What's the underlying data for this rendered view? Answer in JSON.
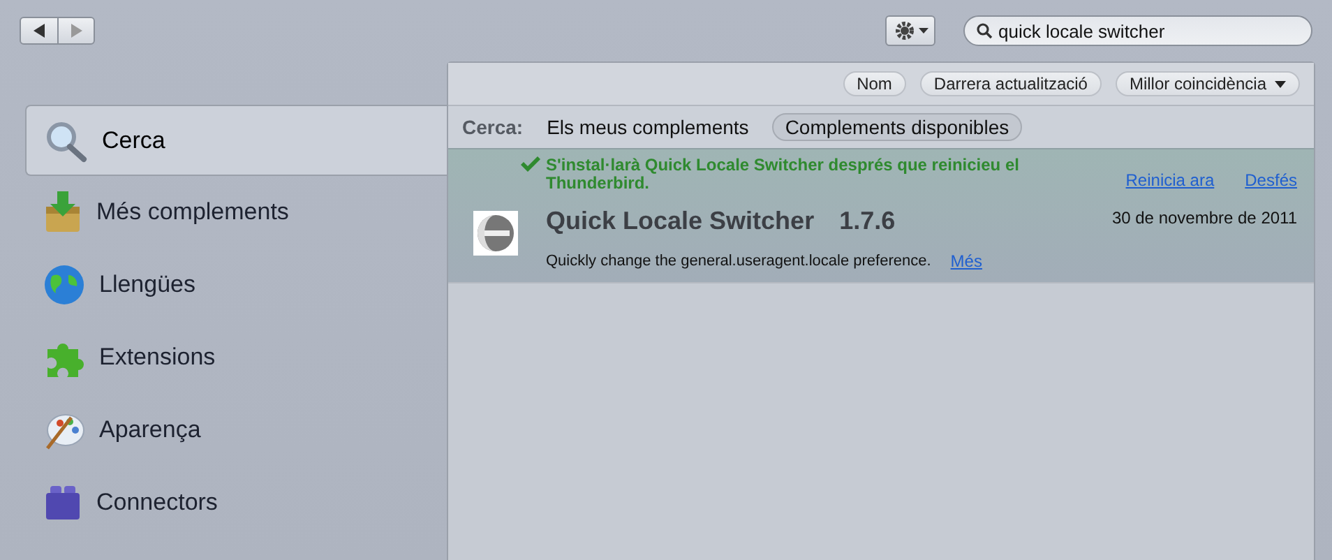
{
  "toolbar": {
    "search": {
      "value": "quick locale switcher"
    }
  },
  "sidebar": {
    "items": [
      {
        "label": "Cerca",
        "selected": true
      },
      {
        "label": "Més complements",
        "selected": false
      },
      {
        "label": "Llengües",
        "selected": false
      },
      {
        "label": "Extensions",
        "selected": false
      },
      {
        "label": "Aparença",
        "selected": false
      },
      {
        "label": "Connectors",
        "selected": false
      }
    ]
  },
  "sort_buttons": [
    {
      "label": "Nom",
      "dropdown": false
    },
    {
      "label": "Darrera actualització",
      "dropdown": false
    },
    {
      "label": "Millor coincidència",
      "dropdown": true
    }
  ],
  "filter": {
    "label": "Cerca:",
    "options": [
      {
        "label": "Els meus complements",
        "selected": false
      },
      {
        "label": "Complements disponibles",
        "selected": true
      }
    ]
  },
  "results": [
    {
      "notice": "S'instal·larà Quick Locale Switcher després que reinicieu el Thunderbird.",
      "actions": [
        "Reinicia ara",
        "Desfés"
      ],
      "name": "Quick Locale Switcher",
      "version": "1.7.6",
      "date": "30 de novembre de 2011",
      "description": "Quickly change the general.useragent.locale preference.",
      "more": "Més"
    }
  ]
}
